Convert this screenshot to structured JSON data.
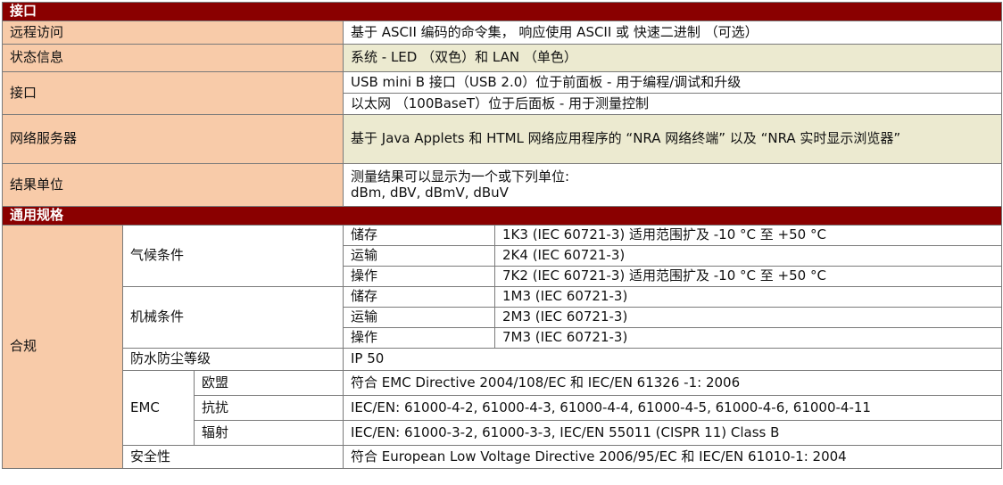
{
  "sections": {
    "interface": "接口",
    "general": "通用规格"
  },
  "interface_rows": [
    {
      "label": "远程访问",
      "value": "基于 ASCII 编码的命令集， 响应使用 ASCII 或 快速二进制 （可选）"
    },
    {
      "label": "状态信息",
      "value": "系统 - LED （双色）和 LAN （单色）"
    },
    {
      "label": "接口",
      "values": [
        "USB mini B 接口（USB 2.0）位于前面板 - 用于编程/调试和升级",
        "以太网 （100BaseT）位于后面板 - 用于测量控制"
      ]
    },
    {
      "label": "网络服务器",
      "value": "基于 Java Applets 和 HTML 网络应用程序的 “NRA 网络终端” 以及 “NRA 实时显示浏览器”"
    },
    {
      "label": "结果单位",
      "values": [
        "测量结果可以显示为一个或下列单位:",
        "dBm, dBV, dBmV, dBuV"
      ]
    }
  ],
  "general": {
    "label": "合规",
    "climate": {
      "label": "气候条件",
      "rows": [
        {
          "k": "储存",
          "v": "1K3 (IEC 60721-3) 适用范围扩及 -10 °C 至 +50 °C"
        },
        {
          "k": "运输",
          "v": "2K4 (IEC 60721-3)"
        },
        {
          "k": "操作",
          "v": "7K2 (IEC 60721-3) 适用范围扩及 -10 °C 至 +50 °C"
        }
      ]
    },
    "mechanical": {
      "label": "机械条件",
      "rows": [
        {
          "k": "储存",
          "v": "1M3 (IEC 60721-3)"
        },
        {
          "k": "运输",
          "v": "2M3 (IEC 60721-3)"
        },
        {
          "k": "操作",
          "v": "7M3 (IEC 60721-3)"
        }
      ]
    },
    "ip": {
      "label": "防水防尘等级",
      "value": "IP 50"
    },
    "emc": {
      "label": "EMC",
      "rows": [
        {
          "k": "欧盟",
          "v": "符合 EMC Directive 2004/108/EC 和 IEC/EN 61326 -1: 2006"
        },
        {
          "k": "抗扰",
          "v": "IEC/EN: 61000-4-2, 61000-4-3, 61000-4-4, 61000-4-5, 61000-4-6, 61000-4-11"
        },
        {
          "k": "辐射",
          "v": "IEC/EN: 61000-3-2, 61000-3-3, IEC/EN 55011 (CISPR 11) Class B"
        }
      ]
    },
    "safety": {
      "label": "安全性",
      "value": "符合 European Low Voltage Directive 2006/95/EC 和 IEC/EN 61010-1: 2004"
    }
  }
}
